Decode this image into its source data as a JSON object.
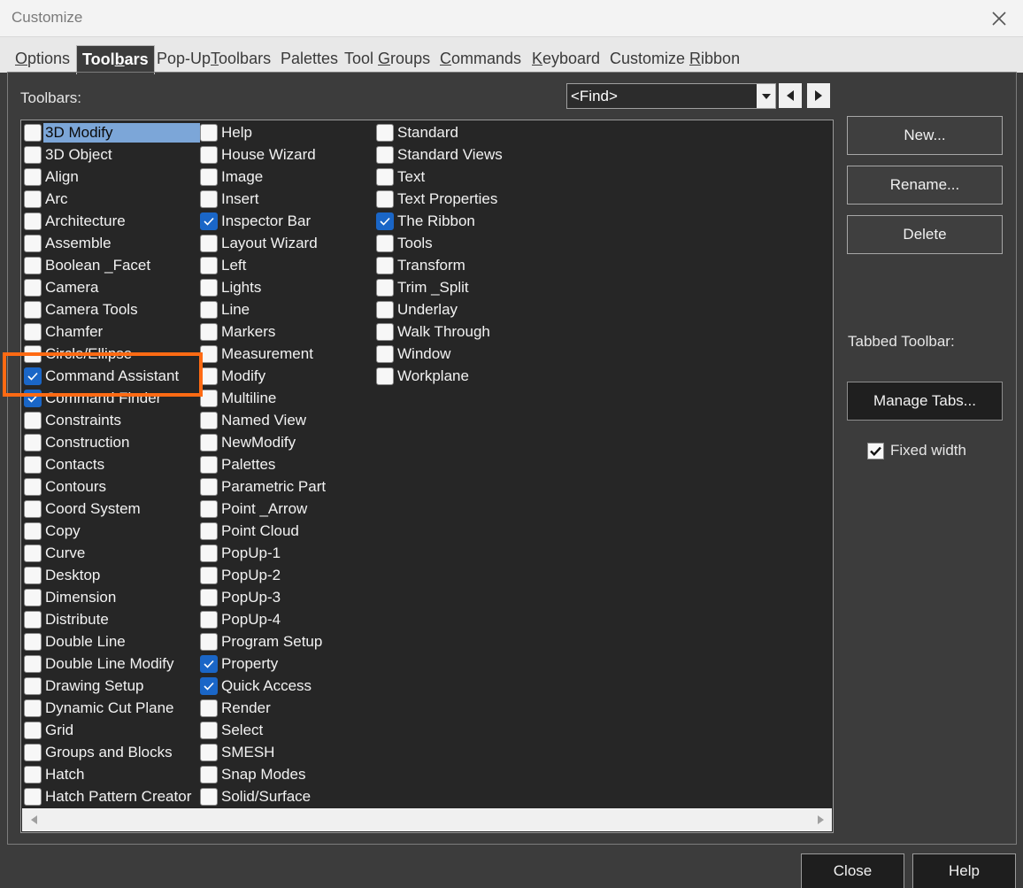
{
  "window": {
    "title": "Customize"
  },
  "tabs": [
    {
      "pre": "",
      "ul": "O",
      "post": "ptions",
      "active": false
    },
    {
      "pre": "Tool",
      "ul": "b",
      "post": "ars",
      "active": true
    },
    {
      "pre": "Pop-Up",
      "ul": "T",
      "post": "oolbars",
      "active": false
    },
    {
      "pre": "Palettes",
      "ul": "",
      "post": "",
      "active": false
    },
    {
      "pre": "Tool ",
      "ul": "G",
      "post": "roups",
      "active": false
    },
    {
      "pre": "",
      "ul": "C",
      "post": "ommands",
      "active": false
    },
    {
      "pre": "",
      "ul": "K",
      "post": "eyboard",
      "active": false
    },
    {
      "pre": "Customize ",
      "ul": "R",
      "post": "ibbon",
      "active": false
    }
  ],
  "toolbars_label": "Toolbars:",
  "find": {
    "value": "<Find>"
  },
  "toolbar_list": {
    "columns": [
      [
        {
          "label": "3D Modify",
          "checked": false,
          "selected": true
        },
        {
          "label": "3D Object",
          "checked": false
        },
        {
          "label": "Align",
          "checked": false
        },
        {
          "label": "Arc",
          "checked": false
        },
        {
          "label": "Architecture",
          "checked": false
        },
        {
          "label": "Assemble",
          "checked": false
        },
        {
          "label": "Boolean _Facet",
          "checked": false
        },
        {
          "label": "Camera",
          "checked": false
        },
        {
          "label": "Camera Tools",
          "checked": false
        },
        {
          "label": "Chamfer",
          "checked": false
        },
        {
          "label": "Circle/Ellipse",
          "checked": false
        },
        {
          "label": "Command Assistant",
          "checked": true
        },
        {
          "label": "Command Finder",
          "checked": true
        },
        {
          "label": "Constraints",
          "checked": false
        },
        {
          "label": "Construction",
          "checked": false
        },
        {
          "label": "Contacts",
          "checked": false
        },
        {
          "label": "Contours",
          "checked": false
        },
        {
          "label": "Coord System",
          "checked": false
        },
        {
          "label": "Copy",
          "checked": false
        },
        {
          "label": "Curve",
          "checked": false
        },
        {
          "label": "Desktop",
          "checked": false
        },
        {
          "label": "Dimension",
          "checked": false
        },
        {
          "label": "Distribute",
          "checked": false
        },
        {
          "label": "Double Line",
          "checked": false
        },
        {
          "label": "Double Line Modify",
          "checked": false
        },
        {
          "label": "Drawing Setup",
          "checked": false
        },
        {
          "label": "Dynamic Cut Plane",
          "checked": false
        },
        {
          "label": "Grid",
          "checked": false
        },
        {
          "label": "Groups and Blocks",
          "checked": false
        },
        {
          "label": "Hatch",
          "checked": false
        },
        {
          "label": "Hatch Pattern Creator",
          "checked": false
        }
      ],
      [
        {
          "label": "Help",
          "checked": false
        },
        {
          "label": "House Wizard",
          "checked": false
        },
        {
          "label": "Image",
          "checked": false
        },
        {
          "label": "Insert",
          "checked": false
        },
        {
          "label": "Inspector Bar",
          "checked": true
        },
        {
          "label": "Layout Wizard",
          "checked": false
        },
        {
          "label": "Left",
          "checked": false
        },
        {
          "label": "Lights",
          "checked": false
        },
        {
          "label": "Line",
          "checked": false
        },
        {
          "label": "Markers",
          "checked": false
        },
        {
          "label": "Measurement",
          "checked": false
        },
        {
          "label": "Modify",
          "checked": false
        },
        {
          "label": "Multiline",
          "checked": false
        },
        {
          "label": "Named View",
          "checked": false
        },
        {
          "label": "NewModify",
          "checked": false
        },
        {
          "label": "Palettes",
          "checked": false
        },
        {
          "label": "Parametric Part",
          "checked": false
        },
        {
          "label": "Point _Arrow",
          "checked": false
        },
        {
          "label": "Point Cloud",
          "checked": false
        },
        {
          "label": "PopUp-1",
          "checked": false
        },
        {
          "label": "PopUp-2",
          "checked": false
        },
        {
          "label": "PopUp-3",
          "checked": false
        },
        {
          "label": "PopUp-4",
          "checked": false
        },
        {
          "label": "Program Setup",
          "checked": false
        },
        {
          "label": "Property",
          "checked": true
        },
        {
          "label": "Quick Access",
          "checked": true
        },
        {
          "label": "Render",
          "checked": false
        },
        {
          "label": "Select",
          "checked": false
        },
        {
          "label": "SMESH",
          "checked": false
        },
        {
          "label": "Snap Modes",
          "checked": false
        },
        {
          "label": "Solid/Surface",
          "checked": false
        }
      ],
      [
        {
          "label": "Standard",
          "checked": false
        },
        {
          "label": "Standard Views",
          "checked": false
        },
        {
          "label": "Text",
          "checked": false
        },
        {
          "label": "Text Properties",
          "checked": false
        },
        {
          "label": "The Ribbon",
          "checked": true
        },
        {
          "label": "Tools",
          "checked": false
        },
        {
          "label": "Transform",
          "checked": false
        },
        {
          "label": "Trim _Split",
          "checked": false
        },
        {
          "label": "Underlay",
          "checked": false
        },
        {
          "label": "Walk Through",
          "checked": false
        },
        {
          "label": "Window",
          "checked": false
        },
        {
          "label": "Workplane",
          "checked": false
        }
      ]
    ]
  },
  "side_buttons": {
    "new": "New...",
    "rename": "Rename...",
    "delete": "Delete"
  },
  "tabbed_toolbar_label": "Tabbed Toolbar:",
  "manage_tabs": "Manage Tabs...",
  "fixed_width": {
    "label": "Fixed width",
    "checked": true
  },
  "footer": {
    "close": "Close",
    "help": "Help"
  },
  "colors": {
    "highlight": "#ff6a13",
    "check_blue": "#1a66c7",
    "selection": "#7ca6d8"
  }
}
